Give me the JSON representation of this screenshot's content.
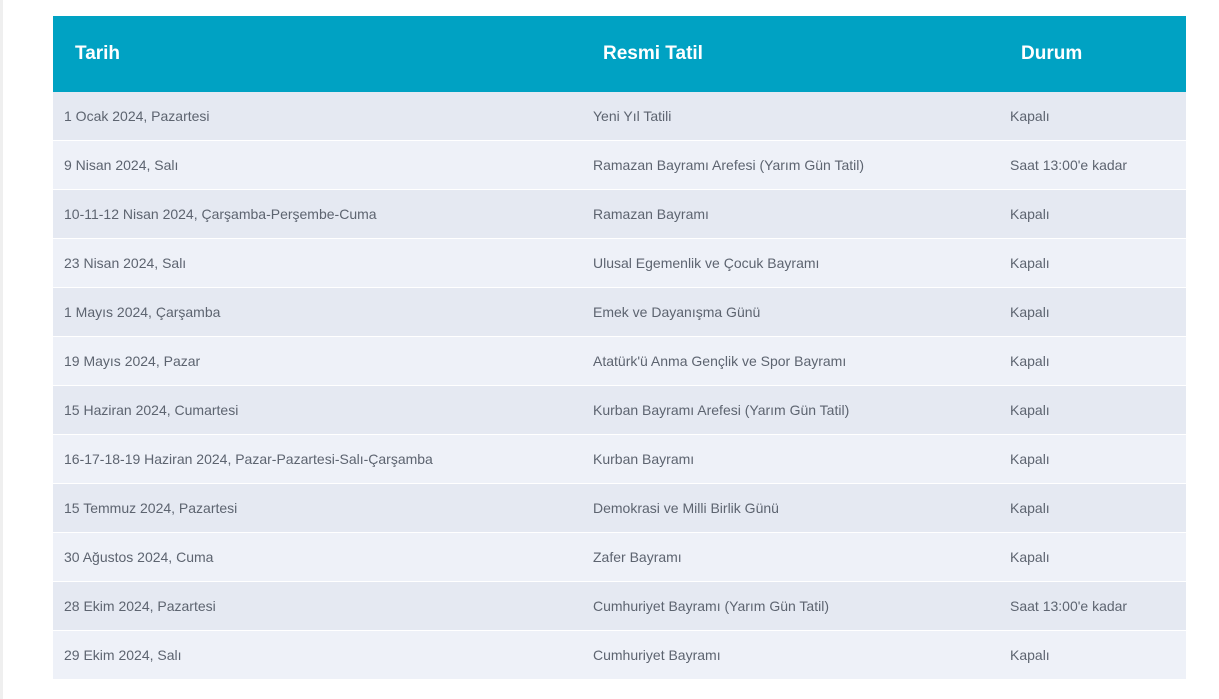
{
  "table": {
    "headers": {
      "date": "Tarih",
      "holiday": "Resmi Tatil",
      "status": "Durum"
    },
    "rows": [
      {
        "date": "1 Ocak 2024, Pazartesi",
        "holiday": "Yeni Yıl Tatili",
        "status": "Kapalı"
      },
      {
        "date": "9 Nisan 2024, Salı",
        "holiday": "Ramazan Bayramı Arefesi (Yarım Gün Tatil)",
        "status": "Saat 13:00'e kadar"
      },
      {
        "date": "10-11-12 Nisan 2024, Çarşamba-Perşembe-Cuma",
        "holiday": "Ramazan Bayramı",
        "status": "Kapalı"
      },
      {
        "date": "23 Nisan 2024, Salı",
        "holiday": "Ulusal Egemenlik ve Çocuk Bayramı",
        "status": "Kapalı"
      },
      {
        "date": "1 Mayıs 2024, Çarşamba",
        "holiday": "Emek ve Dayanışma Günü",
        "status": "Kapalı"
      },
      {
        "date": "19 Mayıs 2024, Pazar",
        "holiday": "Atatürk'ü Anma Gençlik ve Spor Bayramı",
        "status": "Kapalı"
      },
      {
        "date": "15 Haziran 2024, Cumartesi",
        "holiday": "Kurban Bayramı Arefesi (Yarım Gün Tatil)",
        "status": "Kapalı"
      },
      {
        "date": "16-17-18-19 Haziran 2024, Pazar-Pazartesi-Salı-Çarşamba",
        "holiday": "Kurban Bayramı",
        "status": "Kapalı"
      },
      {
        "date": "15 Temmuz 2024, Pazartesi",
        "holiday": "Demokrasi ve Milli Birlik Günü",
        "status": "Kapalı"
      },
      {
        "date": "30 Ağustos 2024, Cuma",
        "holiday": "Zafer Bayramı",
        "status": "Kapalı"
      },
      {
        "date": "28 Ekim 2024, Pazartesi",
        "holiday": "Cumhuriyet Bayramı (Yarım Gün Tatil)",
        "status": "Saat 13:00'e kadar"
      },
      {
        "date": "29 Ekim 2024, Salı",
        "holiday": "Cumhuriyet Bayramı",
        "status": "Kapalı"
      }
    ]
  },
  "colors": {
    "header_bg": "#00a2c3",
    "header_text": "#ffffff",
    "row_odd": "#e5e9f2",
    "row_even": "#eef1f8",
    "body_text": "#5d6470"
  }
}
